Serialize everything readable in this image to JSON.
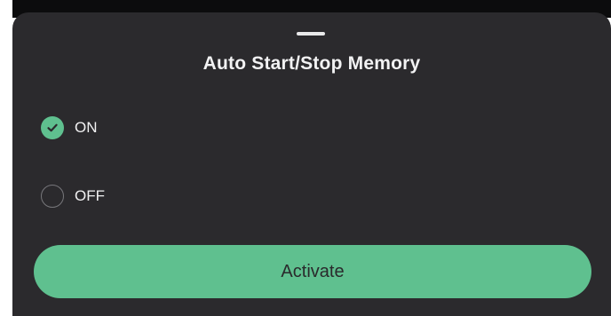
{
  "sheet": {
    "title": "Auto Start/Stop Memory",
    "options": [
      {
        "label": "ON",
        "selected": true
      },
      {
        "label": "OFF",
        "selected": false
      }
    ],
    "activate_label": "Activate"
  },
  "colors": {
    "sheet_background": "#2b2a2d",
    "accent": "#5fc08f",
    "text": "#f2f2f3"
  },
  "icons": {
    "selected": "check-circle-icon",
    "unselected": "empty-radio-icon"
  }
}
